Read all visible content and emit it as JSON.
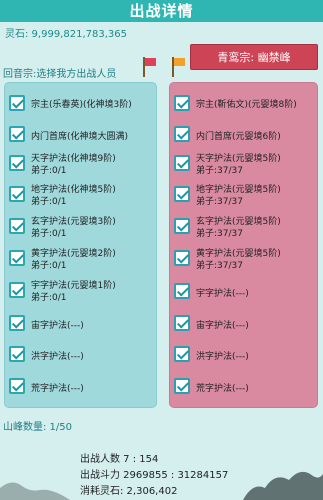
{
  "title": "出战详情",
  "spirit_stone": "灵石: 9,999,821,783,365",
  "enemy_sect": "青鸾宗: 幽禁峰",
  "left_header": "回音宗:选择我方出战人员",
  "left_rows": [
    {
      "name": "宗主(乐春英)(化神境3阶)",
      "sub": ""
    },
    {
      "name": "内门首席(化神境大圆满)",
      "sub": ""
    },
    {
      "name": "天字护法(化神境9阶)",
      "sub": "弟子:0/1"
    },
    {
      "name": "地字护法(化神境5阶)",
      "sub": "弟子:0/1"
    },
    {
      "name": "玄字护法(元婴境3阶)",
      "sub": "弟子:0/1"
    },
    {
      "name": "黄字护法(元婴境2阶)",
      "sub": "弟子:0/1"
    },
    {
      "name": "宇字护法(元婴境1阶)",
      "sub": "弟子:0/1"
    },
    {
      "name": "宙字护法(---)",
      "sub": ""
    },
    {
      "name": "洪字护法(---)",
      "sub": ""
    },
    {
      "name": "荒字护法(---)",
      "sub": ""
    }
  ],
  "right_rows": [
    {
      "name": "宗主(靳佑文)(元婴境8阶)",
      "sub": ""
    },
    {
      "name": "内门首席(元婴境6阶)",
      "sub": ""
    },
    {
      "name": "天字护法(元婴境5阶)",
      "sub": "弟子:37/37"
    },
    {
      "name": "地字护法(元婴境5阶)",
      "sub": "弟子:37/37"
    },
    {
      "name": "玄字护法(元婴境5阶)",
      "sub": "弟子:37/37"
    },
    {
      "name": "黄字护法(元婴境5阶)",
      "sub": "弟子:37/37"
    },
    {
      "name": "宇字护法(---)",
      "sub": ""
    },
    {
      "name": "宙字护法(---)",
      "sub": ""
    },
    {
      "name": "洪字护法(---)",
      "sub": ""
    },
    {
      "name": "荒字护法(---)",
      "sub": ""
    }
  ],
  "peak_count": "山峰数量: 1/50",
  "summary": {
    "fighters": "出战人数 7 : 154",
    "power": "出战斗力 2969855 : 31284157",
    "cost": "消耗灵石: 2,306,402"
  },
  "colors": {
    "accent": "#2fb6b2",
    "enemy": "#cc4455",
    "left_panel": "#9fd9dc",
    "right_panel": "#d98aa0"
  }
}
